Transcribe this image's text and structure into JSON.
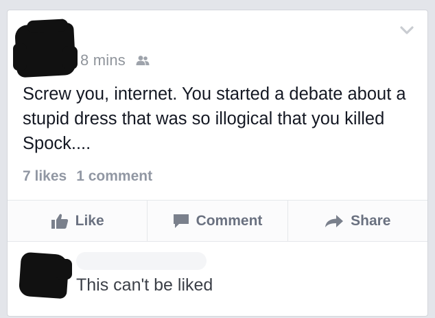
{
  "post": {
    "time": "8 mins",
    "privacy_icon": "friends-icon",
    "text": "Screw you, internet. You started a debate about a stupid dress that was so illogical that you killed Spock....",
    "likes": "7 likes",
    "comments": "1 comment",
    "options_icon": "chevron-down-icon"
  },
  "actions": {
    "like": "Like",
    "comment": "Comment",
    "share": "Share"
  },
  "comment": {
    "text": "This can't be liked"
  },
  "colors": {
    "background": "#e3e5ea",
    "card": "#ffffff",
    "text": "#141823",
    "muted": "#9197a3",
    "action": "#6a7180"
  }
}
